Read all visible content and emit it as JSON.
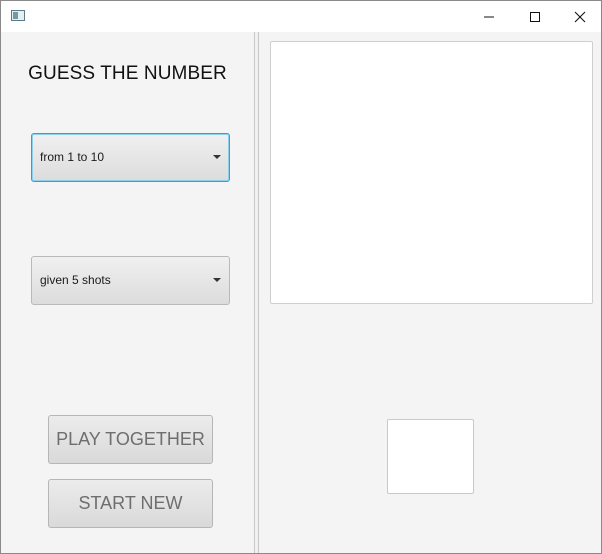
{
  "window": {
    "title": "",
    "icon": "app-window-icon",
    "controls": {
      "minimize_icon": "minimize-icon",
      "maximize_icon": "maximize-icon",
      "close_icon": "close-icon"
    }
  },
  "left_panel": {
    "title": "GUESS THE NUMBER",
    "range_select": {
      "selected": "from 1 to 10"
    },
    "shots_select": {
      "selected": "given 5 shots"
    },
    "buttons": {
      "play_together": "PLAY TOGETHER",
      "start_new": "START NEW"
    }
  },
  "right_panel": {
    "output_text": "",
    "guess_value": ""
  },
  "colors": {
    "focus_accent": "#2aa3d6",
    "background": "#f4f4f4",
    "button_text": "#6e6e6e"
  }
}
